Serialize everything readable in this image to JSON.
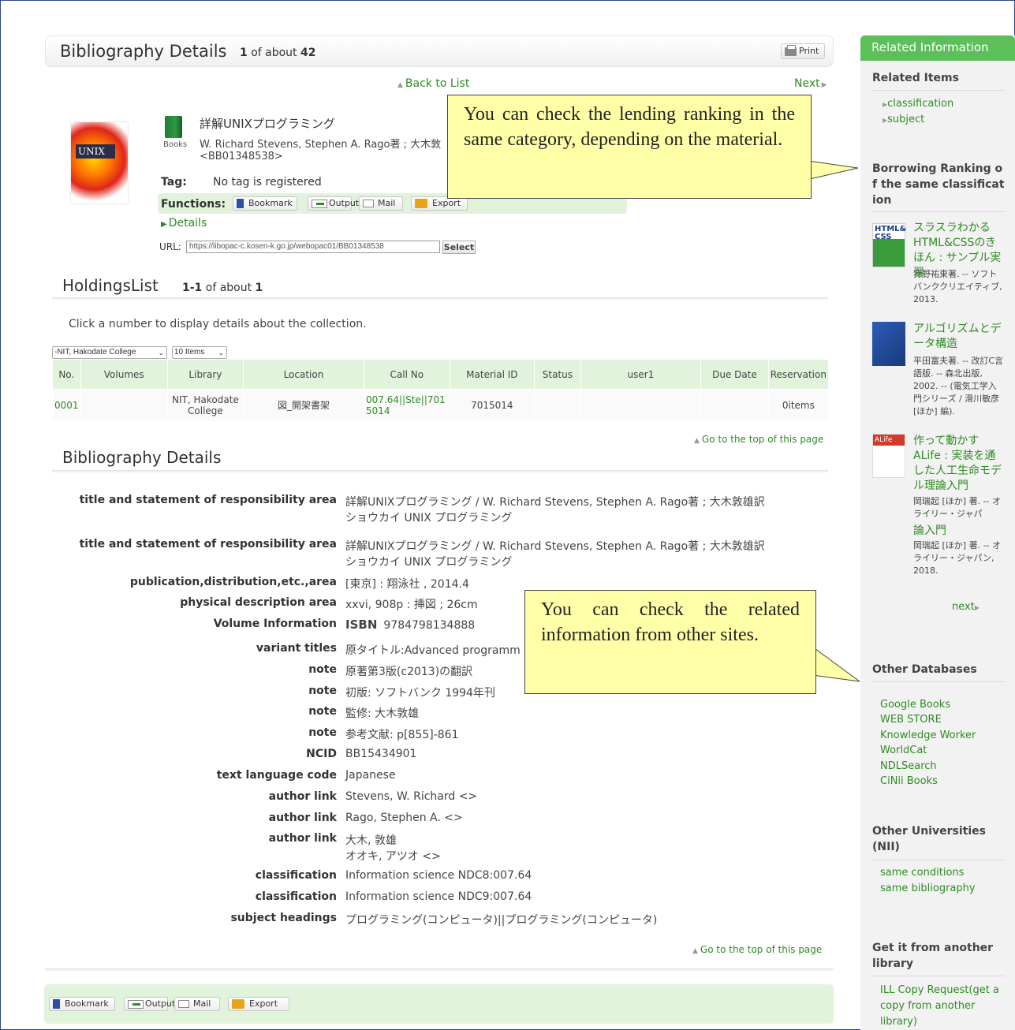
{
  "header": {
    "title": "Bibliography Details",
    "count_prefix": "1",
    "count_text": " of about ",
    "count_total": "42",
    "print_label": "Print"
  },
  "nav": {
    "back": "Back to List",
    "next": "Next"
  },
  "book": {
    "type": "Books",
    "title": "詳解UNIXプログラミング",
    "authors": "W. Richard Stevens, Stephen A. Rago著 ; 大木敦",
    "bb": "<BB01348538>",
    "cover_text": "UNIX"
  },
  "tag": {
    "label": "Tag:",
    "value": "No tag is registered"
  },
  "functions": {
    "label": "Functions:",
    "bookmark": "Bookmark",
    "output": "Output",
    "mail": "Mail",
    "export": "Export"
  },
  "details_link": "Details",
  "url": {
    "label": "URL:",
    "value": "https://libopac-c.kosen-k.go.jp/webopac01/BB01348538",
    "select": "Select"
  },
  "holdings": {
    "title": "HoldingsList",
    "range": "1-1",
    "of_about": " of about ",
    "total": "1",
    "hint": "Click a number to display details about the collection.",
    "library_select": "-NIT, Hakodate College",
    "items_select": "10 Items",
    "columns": [
      "No.",
      "Volumes",
      "Library",
      "Location",
      "Call No",
      "Material ID",
      "Status",
      "user1",
      "Due Date",
      "Reservation"
    ],
    "rows": [
      {
        "no": "0001",
        "volumes": "",
        "library": "NIT, Hakodate College",
        "location": "図_開架書架",
        "call_no": "007.64||Ste||7015014",
        "material_id": "7015014",
        "status": "",
        "user1": "",
        "due": "",
        "reservation": "0items"
      }
    ]
  },
  "top_link": "Go to the top of this page",
  "bib": {
    "title": "Bibliography Details",
    "fields": [
      {
        "label": "title and statement of responsibility area",
        "value": "詳解UNIXプログラミング / W. Richard Stevens, Stephen A. Rago著 ; 大木敦雄訳",
        "value2": "ショウカイ UNIX プログラミング"
      },
      {
        "label": "title and statement of responsibility area",
        "value": "詳解UNIXプログラミング / W. Richard Stevens, Stephen A. Rago著 ; 大木敦雄訳",
        "value2": "ショウカイ UNIX プログラミング"
      },
      {
        "label": "publication,distribution,etc.,area",
        "value": "[東京] : 翔泳社 , 2014.4"
      },
      {
        "label": "physical description area",
        "value": "xxvi, 908p : 挿図 ; 26cm"
      },
      {
        "label": "Volume Information",
        "value": "9784798134888",
        "isbn": "ISBN"
      },
      {
        "label": "variant titles",
        "value": "原タイトル:Advanced programm"
      },
      {
        "label": "note",
        "value": "原著第3版(c2013)の翻訳"
      },
      {
        "label": "note",
        "value": "初版: ソフトバンク 1994年刊"
      },
      {
        "label": "note",
        "value": "監修: 大木敦雄"
      },
      {
        "label": "note",
        "value": "参考文献: p[855]-861"
      },
      {
        "label": "NCID",
        "value": "BB15434901"
      },
      {
        "label": "text language code",
        "value": "Japanese"
      },
      {
        "label": "author link",
        "value": "Stevens, W. Richard <>"
      },
      {
        "label": "author link",
        "value": "Rago, Stephen A. <>"
      },
      {
        "label": "author link",
        "value": "大木, 敦雄",
        "value2": "オオキ, アツオ <>"
      },
      {
        "label": "classification",
        "value": "Information science NDC8:007.64"
      },
      {
        "label": "classification",
        "value": "Information science NDC9:007.64"
      },
      {
        "label": "subject headings",
        "value": "プログラミング(コンピュータ)||プログラミング(コンピュータ)"
      }
    ]
  },
  "sidebar": {
    "title": "Related Information",
    "related_items_title": "Related Items",
    "related_items": [
      "classification",
      "subject"
    ],
    "ranking_title": "Borrowing Ranking of the same classification",
    "ranking": [
      {
        "title": "スラスラわかるHTML&CSSのきほん : サンプル実習",
        "meta": "狩野祐東著. -- ソフトバンククリエイティブ, 2013.",
        "cover": "HTML& CSS"
      },
      {
        "title": "アルゴリズムとデータ構造",
        "meta": "平田富夫著. -- 改訂C言語版. -- 森北出版, 2002. -- (電気工学入門シリーズ / 滑川敏彦 [ほか] 編)."
      },
      {
        "title": "作って動かすALife : 実装を通した人工生命モデル理論入門",
        "meta": "岡瑞起 [ほか] 著. -- オライリー・ジャパ",
        "title2": "論入門",
        "meta2": "岡瑞起 [ほか] 著. -- オライリー・ジャパン, 2018.",
        "cover": "ALife"
      }
    ],
    "next": "next",
    "other_db_title": "Other Databases",
    "other_db": [
      "Google Books",
      "WEB STORE",
      "Knowledge Worker",
      "WorldCat",
      "NDLSearch",
      "CiNii Books"
    ],
    "other_univ_title": "Other Universities (NII)",
    "other_univ": [
      "same conditions",
      "same bibliography"
    ],
    "another_lib_title": "Get it from another library",
    "another_lib": "ILL Copy Request(get a copy from another library)"
  },
  "callouts": {
    "ranking": "You can check the lending ranking in the same category, depending on the material.",
    "related": "You can check the related information from other sites."
  },
  "colors": {
    "accent_green": "#2e8b22",
    "sidebar_head": "#5cbf5a",
    "callout_bg": "#ffffa8",
    "table_head": "#e2f3dc"
  }
}
